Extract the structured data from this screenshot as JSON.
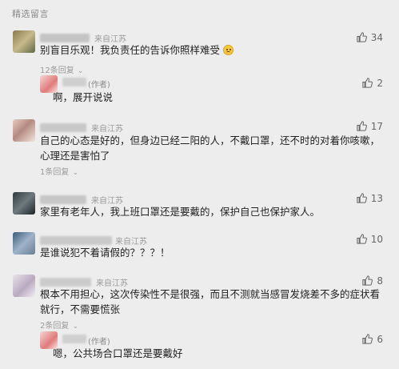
{
  "section_title": "精选留言",
  "location_prefix": "来自江苏",
  "author_tag": "(作者)",
  "comments": [
    {
      "text": "别盲目乐观！我负责任的告诉你照样难受",
      "likes": "34",
      "replies": "12条回复"
    },
    {
      "text": "啊，展开说说",
      "likes": "2",
      "is_author_reply": true
    },
    {
      "text": "自己的心态是好的，但身边已经二阳的人，不戴口罩，还不时的对着你咳嗽，心理还是害怕了",
      "likes": "17",
      "replies": "1条回复"
    },
    {
      "text": "家里有老年人，我上班口罩还是要戴的，保护自己也保护家人。",
      "likes": "13"
    },
    {
      "text": "是谁说犯不着请假的？？？！",
      "likes": "10"
    },
    {
      "text": "根本不用担心，这次传染性不是很强，而且不测就当感冒发烧差不多的症状看就行，不需要慌张",
      "likes": "8",
      "replies": "2条回复"
    },
    {
      "text": "嗯，公共场合口罩还是要戴好",
      "likes": "6",
      "is_author_reply": true
    }
  ],
  "colors": {
    "background": "#ededed",
    "meta": "#9a9a9a",
    "text": "#222222"
  },
  "icons": {
    "like": "thumbs-up-icon",
    "expand": "chevron-down-icon",
    "emoji": "grimace-emoji-icon"
  }
}
